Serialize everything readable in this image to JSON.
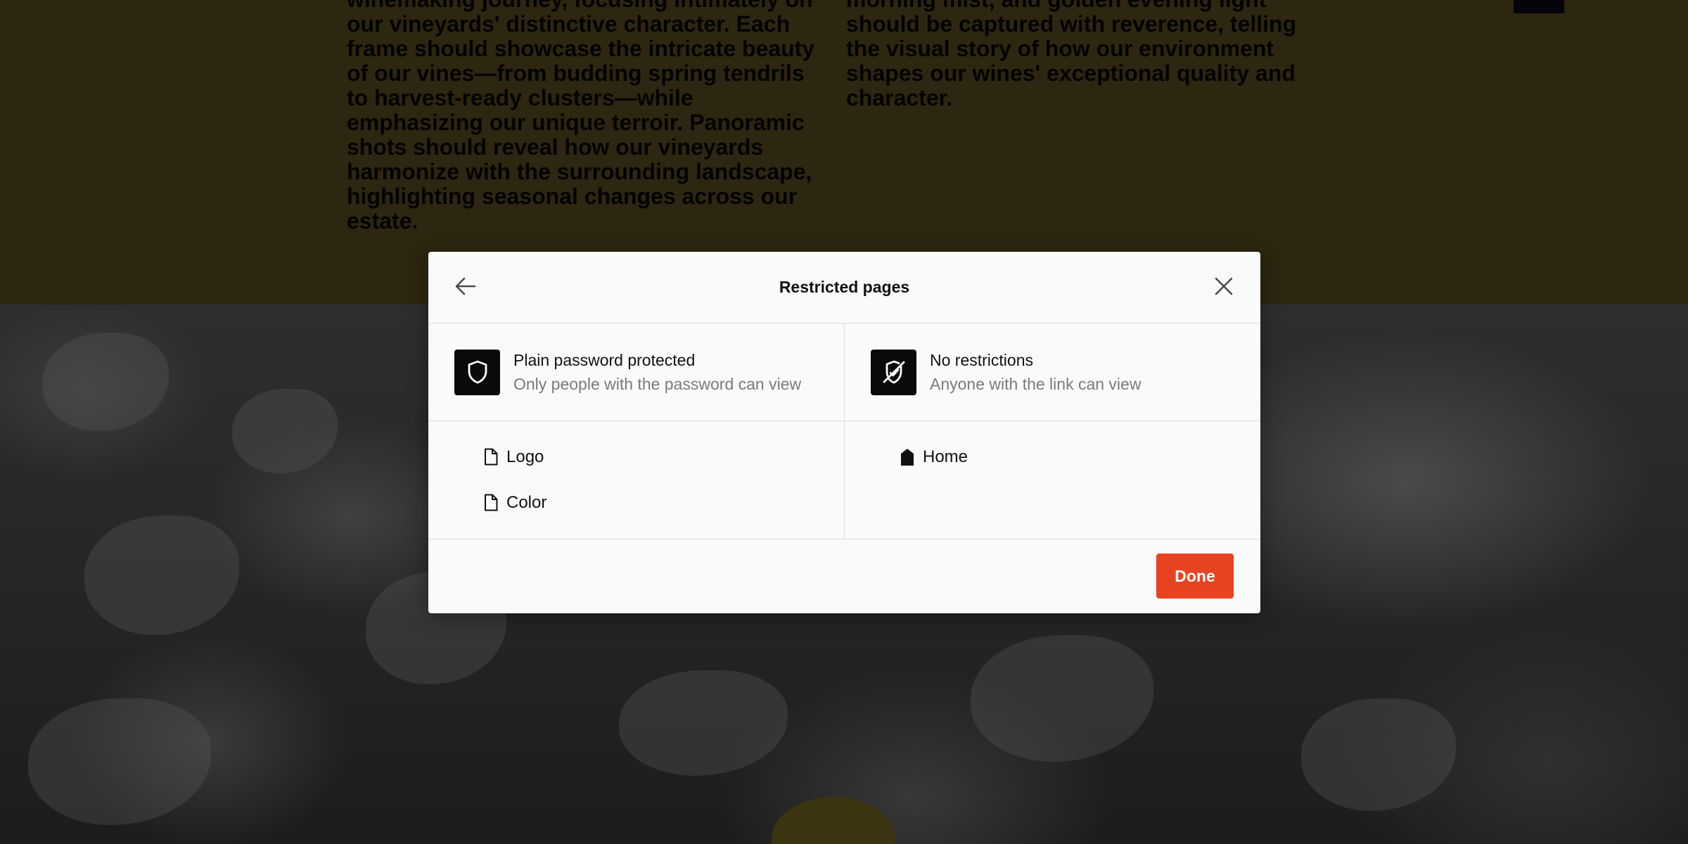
{
  "background": {
    "text_left": "winemaking journey, focusing intimately on our vineyards' distinctive character. Each frame should showcase the intricate beauty of our vines—from budding spring tendrils to harvest-ready clusters—while emphasizing our unique terroir. Panoramic shots should reveal how our vineyards harmonize with the surrounding landscape, highlighting seasonal changes across our estate.",
    "text_right": "morning mist, and golden evening light should be captured with reverence, telling the visual story of how our environment shapes our wines' exceptional quality and character."
  },
  "modal": {
    "title": "Restricted pages",
    "back_icon": "arrow-left-icon",
    "close_icon": "close-icon",
    "columns": [
      {
        "icon": "shield-icon",
        "title": "Plain password protected",
        "subtitle": "Only people with the password can view",
        "pages": [
          {
            "label": "Logo",
            "icon": "page-icon"
          },
          {
            "label": "Color",
            "icon": "page-icon"
          }
        ]
      },
      {
        "icon": "shield-off-icon",
        "title": "No restrictions",
        "subtitle": "Anyone with the link can view",
        "pages": [
          {
            "label": "Home",
            "icon": "home-page-icon"
          }
        ]
      }
    ],
    "done_label": "Done"
  },
  "colors": {
    "accent": "#e84321",
    "modal_bg": "#fafafa",
    "band_bg": "#2d2610"
  }
}
